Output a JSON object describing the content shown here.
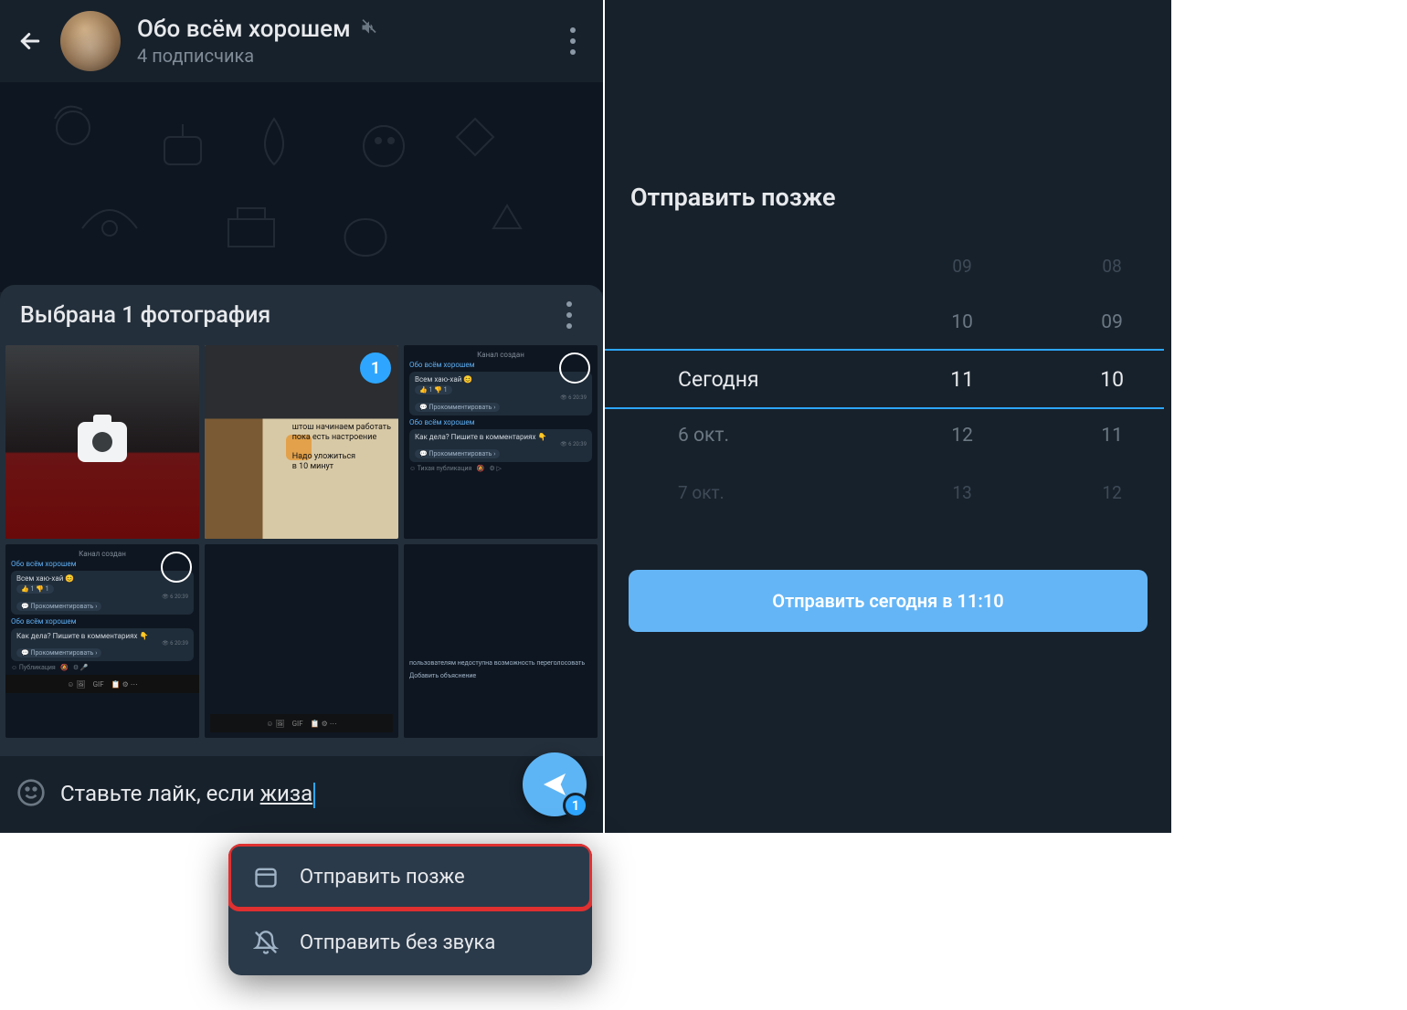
{
  "left": {
    "header": {
      "title": "Обо всём хорошем",
      "subtitle": "4 подписчика"
    },
    "sheet": {
      "title": "Выбрана 1 фотография",
      "selected_index_badge": "1",
      "thumbs": {
        "desk_line1": "штош начинаем работать",
        "desk_line2": "пока есть настроение",
        "desk_line3": "Надо уложиться",
        "desk_line4": "в 10 минут",
        "chat_channel_created": "Канал создан",
        "chat_channel_name": "Обо всём хорошем",
        "chat_msg1": "Всем хаю-хай 😊",
        "chat_comment": "Прокомментировать",
        "chat_msg2": "Как дела? Пишите в комментариях 👇",
        "chat_quiet": "Тихая публикация",
        "chat_pub": "Публикация",
        "chat_views": "👁 6   20:39",
        "chat_react1": "👍 1  👎 1",
        "chat_gif": "GIF",
        "chat_poll": "пользователям недоступна возможность переголосовать",
        "chat_poll2": "Добавить объяснение"
      }
    },
    "menu": {
      "schedule": "Отправить позже",
      "silent": "Отправить без звука"
    },
    "composer": {
      "text_prefix": "Ставьте лайк, если ",
      "text_underlined": "жиза",
      "send_badge": "1"
    }
  },
  "right": {
    "title": "Отправить позже",
    "date_wheel": [
      "",
      "",
      "Сегодня",
      "6 окт.",
      "7 окт."
    ],
    "hour_wheel": [
      "09",
      "10",
      "11",
      "12",
      "13"
    ],
    "minute_wheel": [
      "08",
      "09",
      "10",
      "11",
      "12"
    ],
    "button": "Отправить сегодня в 11:10"
  }
}
